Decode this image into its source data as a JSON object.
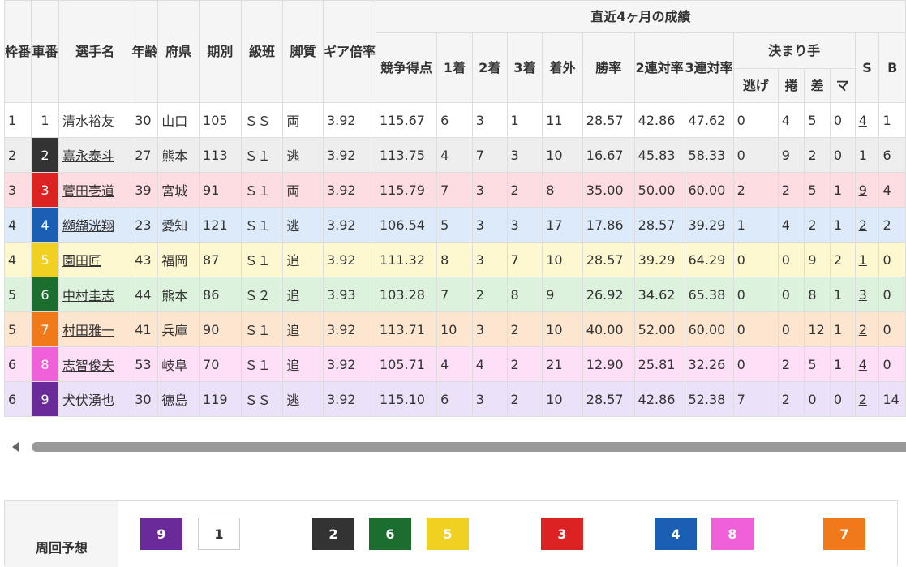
{
  "table": {
    "header": {
      "waku": "枠番",
      "sha": "車番",
      "name": "選手名",
      "age": "年齢",
      "pref": "府県",
      "term": "期別",
      "class": "級班",
      "leg": "脚質",
      "gear": "ギア倍率",
      "recent": "直近4ヶ月の成績",
      "score": "競争得点",
      "first": "1着",
      "second": "2着",
      "third": "3着",
      "out": "着外",
      "win": "勝率",
      "rate2": "2連対率",
      "rate3": "3連対率",
      "kimarite": "決まり手",
      "nige": "逃げ",
      "makuri": "捲",
      "sashi": "差",
      "mark": "マ",
      "s": "S",
      "b": "B"
    },
    "rows": [
      {
        "waku": "1",
        "car": "1",
        "name": "清水裕友",
        "age": "30",
        "pref": "山口",
        "term": "105",
        "cls": "ＳＳ",
        "leg": "両",
        "gear": "3.92",
        "score": "115.67",
        "c1": "6",
        "c2": "3",
        "c3": "1",
        "out": "11",
        "win": "28.57",
        "r2": "42.86",
        "r3": "47.62",
        "nige": "0",
        "makuri": "4",
        "sashi": "5",
        "mark": "0",
        "s": "4",
        "b": "1",
        "rowBg": "#ffffff",
        "carBg": "#ffffff",
        "carFg": "#333333"
      },
      {
        "waku": "2",
        "car": "2",
        "name": "嘉永泰斗",
        "age": "27",
        "pref": "熊本",
        "term": "113",
        "cls": "Ｓ１",
        "leg": "逃",
        "gear": "3.92",
        "score": "113.75",
        "c1": "4",
        "c2": "7",
        "c3": "3",
        "out": "10",
        "win": "16.67",
        "r2": "45.83",
        "r3": "58.33",
        "nige": "0",
        "makuri": "9",
        "sashi": "2",
        "mark": "0",
        "s": "1",
        "b": "6",
        "rowBg": "#eeeeee",
        "carBg": "#333333",
        "carFg": "#ffffff"
      },
      {
        "waku": "3",
        "car": "3",
        "name": "菅田壱道",
        "age": "39",
        "pref": "宮城",
        "term": "91",
        "cls": "Ｓ１",
        "leg": "両",
        "gear": "3.92",
        "score": "115.79",
        "c1": "7",
        "c2": "3",
        "c3": "2",
        "out": "8",
        "win": "35.00",
        "r2": "50.00",
        "r3": "60.00",
        "nige": "2",
        "makuri": "2",
        "sashi": "5",
        "mark": "1",
        "s": "9",
        "b": "4",
        "rowBg": "#fddde2",
        "carBg": "#dd2222",
        "carFg": "#ffffff"
      },
      {
        "waku": "4",
        "car": "4",
        "name": "纐纈洸翔",
        "age": "23",
        "pref": "愛知",
        "term": "121",
        "cls": "Ｓ１",
        "leg": "逃",
        "gear": "3.92",
        "score": "106.54",
        "c1": "5",
        "c2": "3",
        "c3": "3",
        "out": "17",
        "win": "17.86",
        "r2": "28.57",
        "r3": "39.29",
        "nige": "1",
        "makuri": "4",
        "sashi": "2",
        "mark": "1",
        "s": "2",
        "b": "2",
        "rowBg": "#ddeafa",
        "carBg": "#1a5fb4",
        "carFg": "#ffffff"
      },
      {
        "waku": "4",
        "car": "5",
        "name": "園田匠",
        "age": "43",
        "pref": "福岡",
        "term": "87",
        "cls": "Ｓ１",
        "leg": "追",
        "gear": "3.92",
        "score": "111.32",
        "c1": "8",
        "c2": "3",
        "c3": "7",
        "out": "10",
        "win": "28.57",
        "r2": "39.29",
        "r3": "64.29",
        "nige": "0",
        "makuri": "0",
        "sashi": "9",
        "mark": "2",
        "s": "1",
        "b": "0",
        "rowBg": "#fdf8d0",
        "carBg": "#f0d020",
        "carFg": "#ffffff"
      },
      {
        "waku": "5",
        "car": "6",
        "name": "中村圭志",
        "age": "44",
        "pref": "熊本",
        "term": "86",
        "cls": "Ｓ２",
        "leg": "追",
        "gear": "3.93",
        "score": "103.28",
        "c1": "7",
        "c2": "2",
        "c3": "8",
        "out": "9",
        "win": "26.92",
        "r2": "34.62",
        "r3": "65.38",
        "nige": "0",
        "makuri": "0",
        "sashi": "8",
        "mark": "1",
        "s": "3",
        "b": "0",
        "rowBg": "#dcf2dc",
        "carBg": "#1b6e2e",
        "carFg": "#ffffff"
      },
      {
        "waku": "5",
        "car": "7",
        "name": "村田雅一",
        "age": "41",
        "pref": "兵庫",
        "term": "90",
        "cls": "Ｓ１",
        "leg": "追",
        "gear": "3.92",
        "score": "113.71",
        "c1": "10",
        "c2": "3",
        "c3": "2",
        "out": "10",
        "win": "40.00",
        "r2": "52.00",
        "r3": "60.00",
        "nige": "0",
        "makuri": "0",
        "sashi": "12",
        "mark": "1",
        "s": "2",
        "b": "0",
        "rowBg": "#fde6cf",
        "carBg": "#f07a1a",
        "carFg": "#ffffff"
      },
      {
        "waku": "6",
        "car": "8",
        "name": "志智俊夫",
        "age": "53",
        "pref": "岐阜",
        "term": "70",
        "cls": "Ｓ１",
        "leg": "追",
        "gear": "3.92",
        "score": "105.71",
        "c1": "4",
        "c2": "4",
        "c3": "2",
        "out": "21",
        "win": "12.90",
        "r2": "25.81",
        "r3": "32.26",
        "nige": "0",
        "makuri": "2",
        "sashi": "5",
        "mark": "1",
        "s": "4",
        "b": "0",
        "rowBg": "#fde0f7",
        "carBg": "#f060d8",
        "carFg": "#ffffff"
      },
      {
        "waku": "6",
        "car": "9",
        "name": "犬伏湧也",
        "age": "30",
        "pref": "徳島",
        "term": "119",
        "cls": "ＳＳ",
        "leg": "逃",
        "gear": "3.92",
        "score": "115.10",
        "c1": "6",
        "c2": "3",
        "c3": "2",
        "out": "10",
        "win": "28.57",
        "r2": "42.86",
        "r3": "52.38",
        "nige": "7",
        "makuri": "2",
        "sashi": "0",
        "mark": "0",
        "s": "2",
        "b": "14",
        "rowBg": "#ebe2fa",
        "carBg": "#6a2a9a",
        "carFg": "#ffffff"
      }
    ]
  },
  "prediction": {
    "label": "周回予想",
    "boxes": [
      {
        "num": "9",
        "bg": "#6a2a9a",
        "fg": "#ffffff"
      },
      {
        "num": "1",
        "bg": "#ffffff",
        "fg": "#333333"
      },
      {
        "num": "2",
        "bg": "#333333",
        "fg": "#ffffff"
      },
      {
        "num": "6",
        "bg": "#1b6e2e",
        "fg": "#ffffff"
      },
      {
        "num": "5",
        "bg": "#f0d020",
        "fg": "#ffffff"
      },
      {
        "num": "3",
        "bg": "#dd2222",
        "fg": "#ffffff"
      },
      {
        "num": "4",
        "bg": "#1a5fb4",
        "fg": "#ffffff"
      },
      {
        "num": "8",
        "bg": "#f060d8",
        "fg": "#ffffff"
      },
      {
        "num": "7",
        "bg": "#f07a1a",
        "fg": "#ffffff"
      }
    ]
  }
}
